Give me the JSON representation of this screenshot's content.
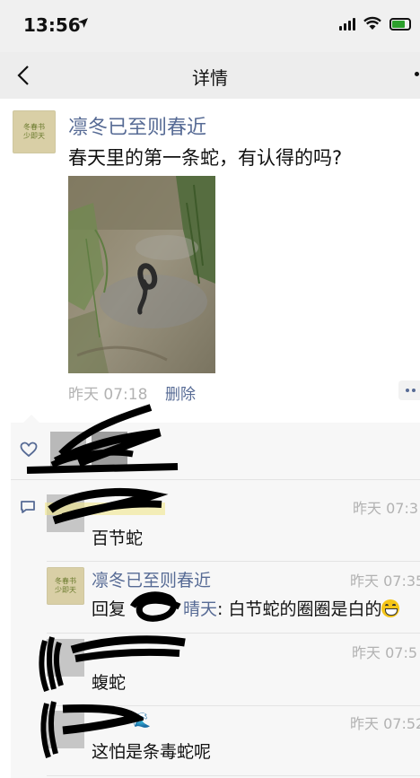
{
  "status_bar": {
    "time": "13:56",
    "location_icon": "location-arrow-icon",
    "signal_icon": "cellular-signal-icon",
    "wifi_icon": "wifi-icon",
    "battery_icon": "battery-charging-icon"
  },
  "nav": {
    "title": "详情",
    "back_icon": "chevron-left-icon",
    "more_icon": "more-dots-icon"
  },
  "post": {
    "author": "凛冬已至则春近",
    "avatar_text": [
      "冬春书",
      "少即天"
    ],
    "text": "春天里的第一条蛇，有认得的吗?",
    "photo": "snake-photo",
    "time": "昨天 07:18",
    "delete_label": "删除",
    "more_icon": "more-dots-icon"
  },
  "likes": {
    "icon": "heart-icon"
  },
  "comments_icon": "comment-bubble-icon",
  "comments": [
    {
      "time": "昨天 07:3",
      "text": "百节蛇"
    },
    {
      "author": "凛冬已至则春近",
      "time": "昨天 07:35",
      "reply_label": "回复",
      "reply_to_suffix": "晴天",
      "text": ": 白节蛇的圈圈是白的",
      "emoji": "grinning-face-emoji"
    },
    {
      "time": "昨天 07:5",
      "text": "蝮蛇"
    },
    {
      "time": "昨天 07:52",
      "text": "这怕是条毒蛇呢",
      "name_emoji": "wave-emoji"
    }
  ],
  "colors": {
    "link_blue": "#576b95",
    "meta_gray": "#b2b2b2",
    "panel_bg": "#f7f7f7",
    "nav_bg": "#ededed",
    "battery_green": "#2ca02c"
  }
}
